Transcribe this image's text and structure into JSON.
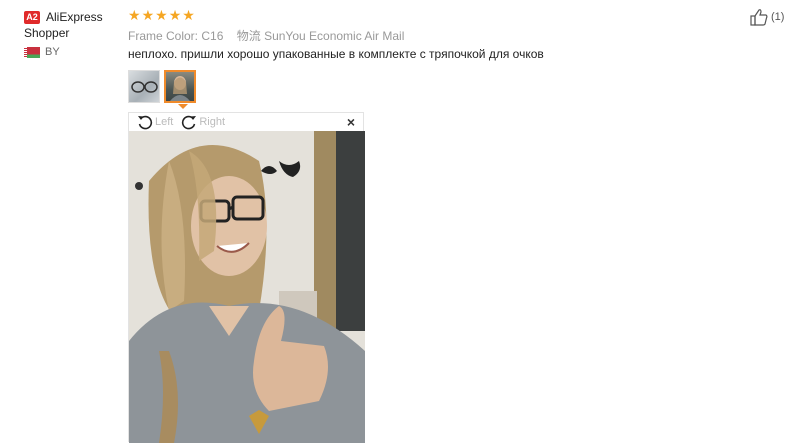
{
  "reviewer": {
    "badge": "A2",
    "name": "AliExpress Shopper",
    "country": "BY"
  },
  "rating": {
    "stars": 5,
    "max": 5
  },
  "attributes": {
    "frame_color_label": "Frame Color:",
    "frame_color_value": "C16",
    "shipping_label": "物流",
    "shipping_value": "SunYou Economic Air Mail"
  },
  "review_text": "неплохо. пришли хорошо упакованные в комплекте с тряпочкой для очков",
  "thumbnails": {
    "count": 2,
    "active_index": 1
  },
  "viewer": {
    "rotate_left_label": "Left",
    "rotate_right_label": "Right",
    "close_symbol": "×"
  },
  "helpful": {
    "count_label": "(1)"
  },
  "colors": {
    "accent_orange": "#f08b2b",
    "star_color": "#f5a623",
    "badge_red": "#e02a2a"
  }
}
